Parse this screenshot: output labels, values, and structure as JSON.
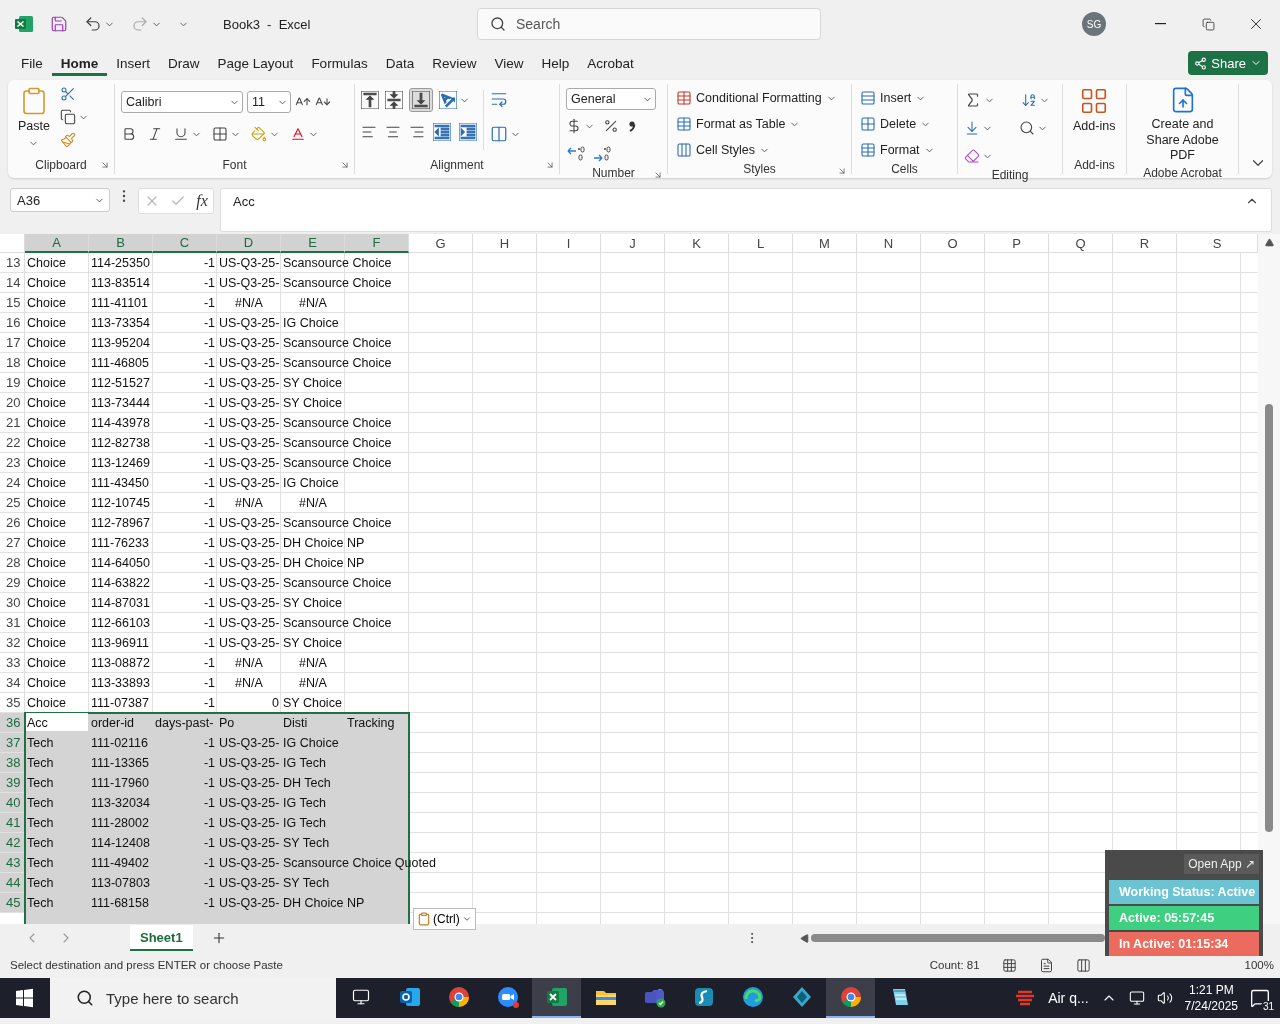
{
  "title_bar": {
    "document_title": "Book3  -  Excel",
    "search_placeholder": "Search",
    "avatar_initials": "SG"
  },
  "ribbon_tabs": [
    {
      "label": "File",
      "selected": false
    },
    {
      "label": "Home",
      "selected": true
    },
    {
      "label": "Insert",
      "selected": false
    },
    {
      "label": "Draw",
      "selected": false
    },
    {
      "label": "Page Layout",
      "selected": false
    },
    {
      "label": "Formulas",
      "selected": false
    },
    {
      "label": "Data",
      "selected": false
    },
    {
      "label": "Review",
      "selected": false
    },
    {
      "label": "View",
      "selected": false
    },
    {
      "label": "Help",
      "selected": false
    },
    {
      "label": "Acrobat",
      "selected": false
    }
  ],
  "share_button": "Share",
  "ribbon": {
    "groups": [
      {
        "kind": "clipboard",
        "label": "Clipboard",
        "buttons": [
          "Paste"
        ]
      },
      {
        "kind": "font",
        "label": "Font",
        "font_name": "Calibri",
        "font_size": "11"
      },
      {
        "kind": "alignment",
        "label": "Alignment",
        "bottom_aligned": true
      },
      {
        "kind": "number",
        "label": "Number",
        "format": "General"
      },
      {
        "kind": "styles",
        "label": "Styles",
        "buttons": [
          "Conditional Formatting",
          "Format as Table",
          "Cell Styles"
        ]
      },
      {
        "kind": "cells",
        "label": "Cells",
        "buttons": [
          "Insert",
          "Delete",
          "Format"
        ]
      },
      {
        "kind": "editing",
        "label": "Editing"
      },
      {
        "kind": "addins",
        "label": "Add-ins",
        "buttons": [
          "Add-ins"
        ]
      },
      {
        "kind": "acrobat",
        "label": "Adobe Acrobat",
        "buttons": [
          "Create and Share Adobe PDF"
        ]
      }
    ]
  },
  "formula_bar": {
    "name_box": "A36",
    "fx": "fx",
    "content": "Acc"
  },
  "grid": {
    "columns": [
      {
        "label": "A",
        "selected": true
      },
      {
        "label": "B",
        "selected": true
      },
      {
        "label": "C",
        "selected": true
      },
      {
        "label": "D",
        "selected": true
      },
      {
        "label": "E",
        "selected": true
      },
      {
        "label": "F",
        "selected": true
      },
      {
        "label": "G",
        "selected": false
      },
      {
        "label": "H",
        "selected": false
      },
      {
        "label": "I",
        "selected": false
      },
      {
        "label": "J",
        "selected": false
      },
      {
        "label": "K",
        "selected": false
      },
      {
        "label": "L",
        "selected": false
      },
      {
        "label": "M",
        "selected": false
      },
      {
        "label": "N",
        "selected": false
      },
      {
        "label": "O",
        "selected": false
      },
      {
        "label": "P",
        "selected": false
      },
      {
        "label": "Q",
        "selected": false
      },
      {
        "label": "R",
        "selected": false
      },
      {
        "label": "S",
        "selected": false
      }
    ],
    "rows": [
      {
        "number": "13",
        "selected": false,
        "cells": [
          "Choice",
          "114-25350",
          "-1",
          "US-Q3-25-",
          "Scansource Choice"
        ]
      },
      {
        "number": "14",
        "selected": false,
        "cells": [
          "Choice",
          "113-83514",
          "-1",
          "US-Q3-25-",
          "Scansource Choice"
        ]
      },
      {
        "number": "15",
        "selected": false,
        "cells": [
          "Choice",
          "111-41101",
          "-1",
          "#N/A",
          "#N/A"
        ]
      },
      {
        "number": "16",
        "selected": false,
        "cells": [
          "Choice",
          "113-73354",
          "-1",
          "US-Q3-25-",
          "IG Choice"
        ]
      },
      {
        "number": "17",
        "selected": false,
        "cells": [
          "Choice",
          "113-95204",
          "-1",
          "US-Q3-25-",
          "Scansource Choice"
        ]
      },
      {
        "number": "18",
        "selected": false,
        "cells": [
          "Choice",
          "111-46805",
          "-1",
          "US-Q3-25-",
          "Scansource Choice"
        ]
      },
      {
        "number": "19",
        "selected": false,
        "cells": [
          "Choice",
          "112-51527",
          "-1",
          "US-Q3-25-",
          "SY Choice"
        ]
      },
      {
        "number": "20",
        "selected": false,
        "cells": [
          "Choice",
          "113-73444",
          "-1",
          "US-Q3-25-",
          "SY Choice"
        ]
      },
      {
        "number": "21",
        "selected": false,
        "cells": [
          "Choice",
          "114-43978",
          "-1",
          "US-Q3-25-",
          "Scansource Choice"
        ]
      },
      {
        "number": "22",
        "selected": false,
        "cells": [
          "Choice",
          "112-82738",
          "-1",
          "US-Q3-25-",
          "Scansource Choice"
        ]
      },
      {
        "number": "23",
        "selected": false,
        "cells": [
          "Choice",
          "113-12469",
          "-1",
          "US-Q3-25-",
          "Scansource Choice"
        ]
      },
      {
        "number": "24",
        "selected": false,
        "cells": [
          "Choice",
          "111-43450",
          "-1",
          "US-Q3-25-",
          "IG Choice"
        ]
      },
      {
        "number": "25",
        "selected": false,
        "cells": [
          "Choice",
          "112-10745",
          "-1",
          "#N/A",
          "#N/A"
        ]
      },
      {
        "number": "26",
        "selected": false,
        "cells": [
          "Choice",
          "112-78967",
          "-1",
          "US-Q3-25-",
          "Scansource Choice"
        ]
      },
      {
        "number": "27",
        "selected": false,
        "cells": [
          "Choice",
          "111-76233",
          "-1",
          "US-Q3-25-",
          "DH Choice NP"
        ]
      },
      {
        "number": "28",
        "selected": false,
        "cells": [
          "Choice",
          "114-64050",
          "-1",
          "US-Q3-25-",
          "DH Choice NP"
        ]
      },
      {
        "number": "29",
        "selected": false,
        "cells": [
          "Choice",
          "114-63822",
          "-1",
          "US-Q3-25-",
          "Scansource Choice"
        ]
      },
      {
        "number": "30",
        "selected": false,
        "cells": [
          "Choice",
          "114-87031",
          "-1",
          "US-Q3-25-",
          "SY Choice"
        ]
      },
      {
        "number": "31",
        "selected": false,
        "cells": [
          "Choice",
          "112-66103",
          "-1",
          "US-Q3-25-",
          "Scansource Choice"
        ]
      },
      {
        "number": "32",
        "selected": false,
        "cells": [
          "Choice",
          "113-96911",
          "-1",
          "US-Q3-25-",
          "SY Choice"
        ]
      },
      {
        "number": "33",
        "selected": false,
        "cells": [
          "Choice",
          "113-08872",
          "-1",
          "#N/A",
          "#N/A"
        ]
      },
      {
        "number": "34",
        "selected": false,
        "cells": [
          "Choice",
          "113-33893",
          "-1",
          "#N/A",
          "#N/A"
        ]
      },
      {
        "number": "35",
        "selected": false,
        "cells": [
          "Choice",
          "111-07387",
          "-1",
          "0",
          "SY Choice"
        ]
      },
      {
        "number": "36",
        "selected": true,
        "active": true,
        "cells": [
          "Acc",
          "order-id",
          "days-past-",
          "Po",
          "Disti",
          "Tracking"
        ]
      },
      {
        "number": "37",
        "selected": true,
        "cells": [
          "Tech",
          "111-02116",
          "-1",
          "US-Q3-25-",
          "IG Choice"
        ]
      },
      {
        "number": "38",
        "selected": true,
        "cells": [
          "Tech",
          "111-13365",
          "-1",
          "US-Q3-25-",
          "IG Tech"
        ]
      },
      {
        "number": "39",
        "selected": true,
        "cells": [
          "Tech",
          "111-17960",
          "-1",
          "US-Q3-25-",
          "DH Tech"
        ]
      },
      {
        "number": "40",
        "selected": true,
        "cells": [
          "Tech",
          "113-32034",
          "-1",
          "US-Q3-25-",
          "IG Tech"
        ]
      },
      {
        "number": "41",
        "selected": true,
        "cells": [
          "Tech",
          "111-28002",
          "-1",
          "US-Q3-25-",
          "IG Tech"
        ]
      },
      {
        "number": "42",
        "selected": true,
        "cells": [
          "Tech",
          "114-12408",
          "-1",
          "US-Q3-25-",
          "SY Tech"
        ]
      },
      {
        "number": "43",
        "selected": true,
        "cells": [
          "Tech",
          "111-49402",
          "-1",
          "US-Q3-25-",
          "Scansource Choice Quoted"
        ]
      },
      {
        "number": "44",
        "selected": true,
        "cells": [
          "Tech",
          "113-07803",
          "-1",
          "US-Q3-25-",
          "SY Tech"
        ]
      },
      {
        "number": "45",
        "selected": true,
        "cells": [
          "Tech",
          "111-68158",
          "-1",
          "US-Q3-25-",
          "DH Choice NP"
        ]
      }
    ]
  },
  "paste_options": "(Ctrl)",
  "sheet_tabs": [
    {
      "label": "Sheet1",
      "selected": true
    }
  ],
  "status_bar": {
    "message": "Select destination and press ENTER or choose Paste",
    "count": "Count: 81",
    "zoom": "100%"
  },
  "tracker_widget": {
    "open_app": "Open App ↗",
    "status": "Working Status: Active",
    "active": "Active: 05:57:45",
    "inactive": "In Active: 01:15:34"
  },
  "taskbar": {
    "search_placeholder": "Type here to search",
    "apps": [
      {
        "kind": "outlook",
        "selected": false
      },
      {
        "kind": "chrome",
        "selected": false
      },
      {
        "kind": "zoom",
        "selected": false
      },
      {
        "kind": "excel",
        "selected": true
      },
      {
        "kind": "explorer",
        "selected": false
      },
      {
        "kind": "teams",
        "selected": false
      },
      {
        "kind": "sapp",
        "selected": false
      },
      {
        "kind": "edge",
        "selected": false
      },
      {
        "kind": "diamond",
        "selected": false
      },
      {
        "kind": "chrome",
        "selected": true
      },
      {
        "kind": "notes",
        "selected": false
      }
    ],
    "weather": "Air q...",
    "time": "1:21 PM",
    "date": "7/24/2025",
    "notifications": "31"
  }
}
